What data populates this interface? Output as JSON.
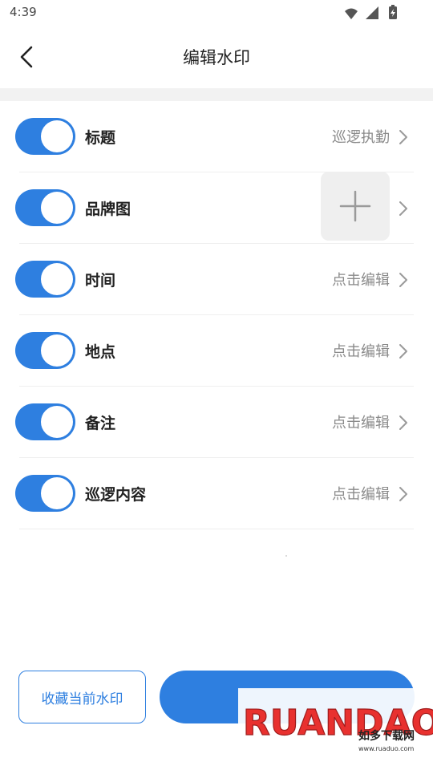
{
  "status_bar": {
    "time": "4:39",
    "icons": [
      "wifi-icon",
      "signal-icon",
      "battery-charging-icon"
    ]
  },
  "header": {
    "title": "编辑水印",
    "back_icon": "chevron-left-icon"
  },
  "settings": [
    {
      "label": "标题",
      "value": "巡逻执勤",
      "enabled": true
    },
    {
      "label": "品牌图",
      "value": "",
      "enabled": true
    },
    {
      "label": "时间",
      "value": "点击编辑",
      "enabled": true
    },
    {
      "label": "地点",
      "value": "点击编辑",
      "enabled": true
    },
    {
      "label": "备注",
      "value": "点击编辑",
      "enabled": true
    },
    {
      "label": "巡逻内容",
      "value": "点击编辑",
      "enabled": true
    }
  ],
  "brand_image": {
    "icon": "plus-icon"
  },
  "footer": {
    "favorite_label": "收藏当前水印",
    "confirm_label": ""
  },
  "watermark": {
    "brand_letters": "RUANDAO",
    "brand_cn": "如多下载网",
    "url": "www.ruaduo.com"
  },
  "colors": {
    "accent": "#2e7fe0",
    "text_primary": "#222222",
    "text_secondary": "#8a8a8a",
    "divider": "#f2f2f2"
  }
}
